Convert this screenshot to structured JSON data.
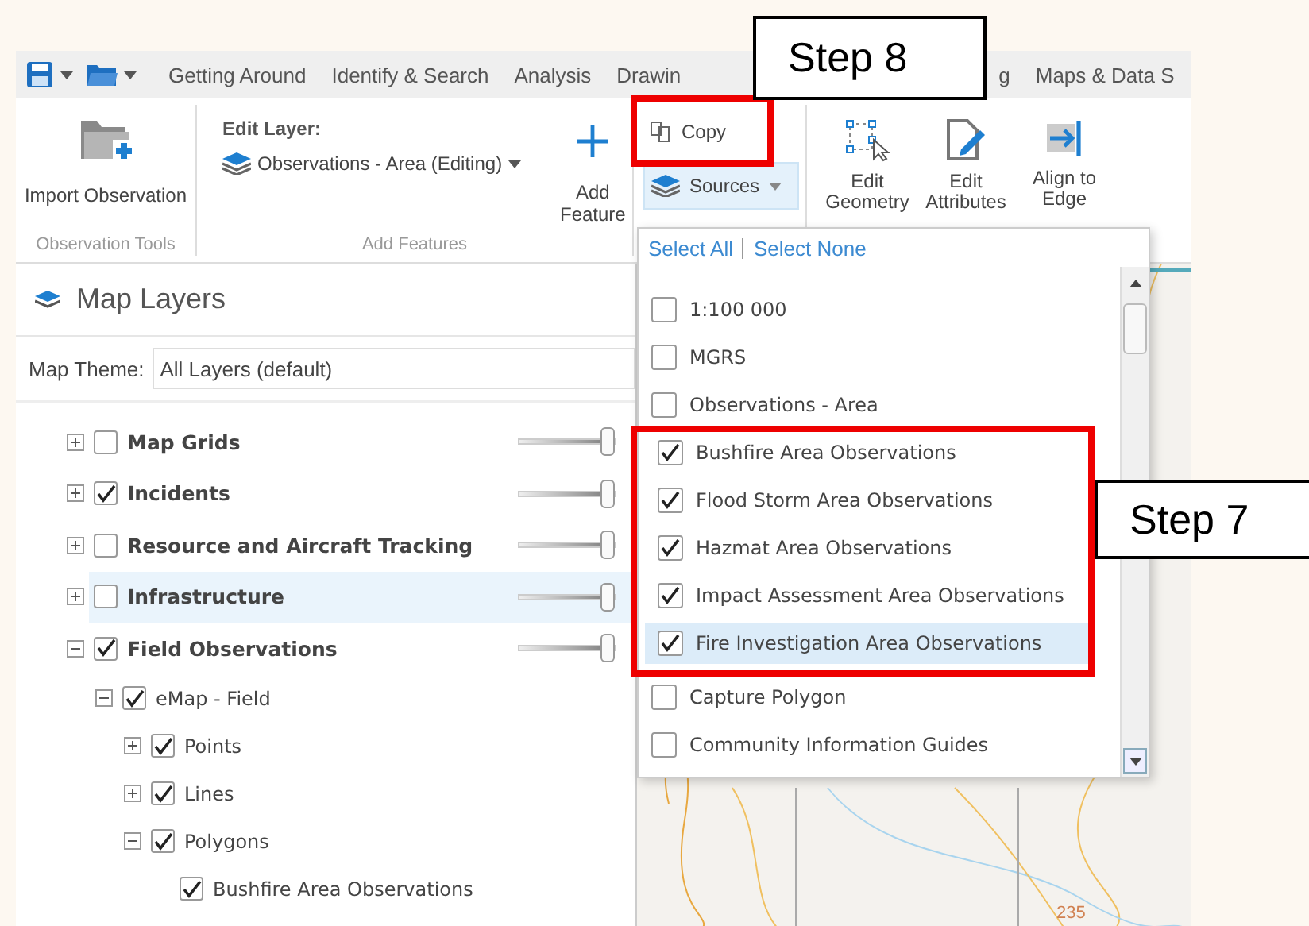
{
  "toolbar": {
    "tabs": [
      "Getting Around",
      "Identify & Search",
      "Analysis",
      "Drawin",
      "g",
      "Maps & Data S"
    ]
  },
  "ribbon": {
    "observation_tools": {
      "button": "Import Observation",
      "label": "Observation Tools"
    },
    "add_features": {
      "edit_layer_label": "Edit Layer:",
      "edit_layer_value": "Observations - Area (Editing)",
      "button": "Add Feature",
      "label": "Add Features"
    },
    "copy": "Copy",
    "sources": "Sources",
    "edit_tools": [
      {
        "kind": "geometry",
        "label": "Edit Geometry"
      },
      {
        "kind": "attributes",
        "label": "Edit Attributes"
      },
      {
        "kind": "align",
        "label": "Align to Edge"
      }
    ]
  },
  "layers_panel": {
    "title": "Map Layers",
    "theme_label": "Map Theme:",
    "theme_value": "All Layers (default)",
    "items": [
      {
        "label": "Map Grids",
        "checked": false,
        "expanded": false,
        "selected": false,
        "level": 1
      },
      {
        "label": "Incidents",
        "checked": true,
        "expanded": false,
        "selected": false,
        "level": 1
      },
      {
        "label": "Resource and Aircraft Tracking",
        "checked": false,
        "expanded": false,
        "selected": false,
        "level": 1
      },
      {
        "label": "Infrastructure",
        "checked": false,
        "expanded": false,
        "selected": true,
        "level": 1
      },
      {
        "label": "Field Observations",
        "checked": true,
        "expanded": true,
        "selected": false,
        "level": 1,
        "children": [
          {
            "label": "eMap - Field",
            "checked": true,
            "expanded": true,
            "selected": false,
            "children": [
              {
                "label": "Points",
                "checked": true,
                "expanded": false,
                "selected": false
              },
              {
                "label": "Lines",
                "checked": true,
                "expanded": false,
                "selected": false
              },
              {
                "label": "Polygons",
                "checked": true,
                "expanded": true,
                "selected": false,
                "children": [
                  {
                    "label": "Bushfire Area Observations",
                    "checked": true,
                    "selected": false
                  }
                ]
              }
            ]
          }
        ]
      }
    ]
  },
  "sources_dropdown": {
    "select_all": "Select All",
    "select_none": "Select None",
    "items_above": [
      {
        "label": "1:100 000",
        "checked": false,
        "selected": false
      },
      {
        "label": "MGRS",
        "checked": false,
        "selected": false
      },
      {
        "label": "Observations - Area",
        "checked": false,
        "selected": false
      }
    ],
    "framed_items": [
      {
        "label": "Bushfire Area Observations",
        "checked": true,
        "selected": false
      },
      {
        "label": "Flood Storm Area Observations",
        "checked": true,
        "selected": false
      },
      {
        "label": "Hazmat Area Observations",
        "checked": true,
        "selected": false
      },
      {
        "label": "Impact Assessment Area Observations",
        "checked": true,
        "selected": false
      },
      {
        "label": "Fire Investigation Area Observations",
        "checked": true,
        "selected": true
      }
    ],
    "items_below": [
      {
        "label": "Capture Polygon",
        "checked": false,
        "selected": false
      },
      {
        "label": "Community Information Guides",
        "checked": false,
        "selected": false
      }
    ]
  },
  "map": {
    "label": "235"
  },
  "callouts": [
    "Step 8",
    "Step 7"
  ]
}
